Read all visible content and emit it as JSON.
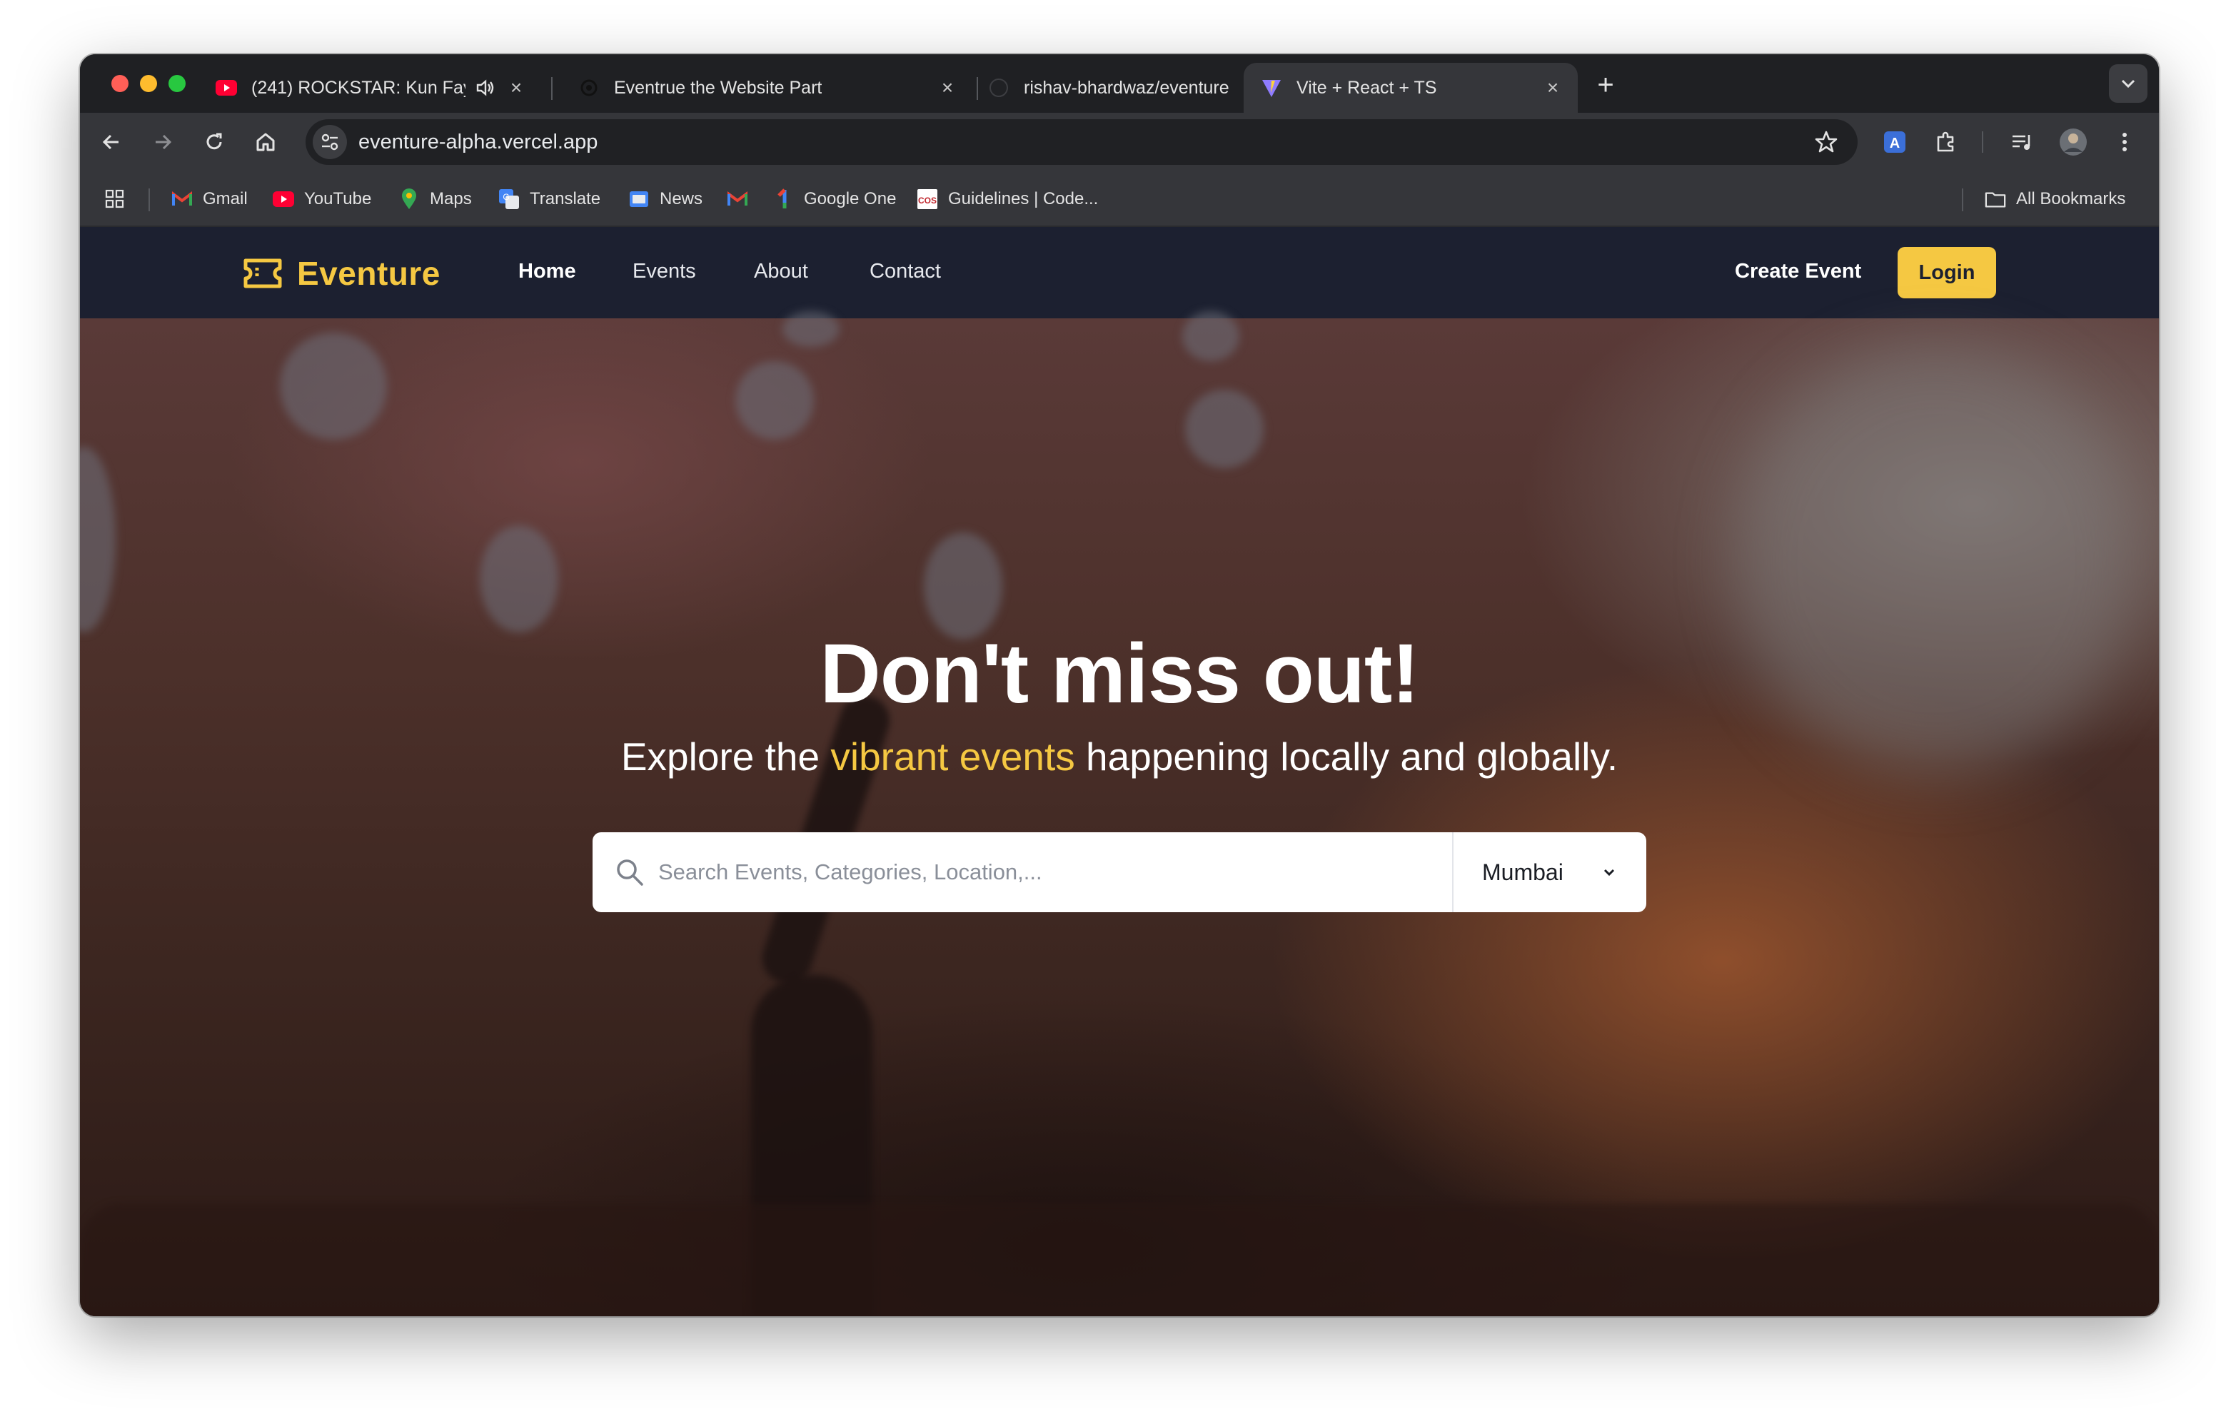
{
  "browser": {
    "tabs": [
      {
        "title": "(241) ROCKSTAR: Kun Faya",
        "favicon": "youtube-icon",
        "audio": true
      },
      {
        "title": "Eventrue the Website Part",
        "favicon": "chatgpt-icon"
      },
      {
        "title": "rishav-bhardwaz/eventure",
        "favicon": "github-icon"
      },
      {
        "title": "Vite + React + TS",
        "favicon": "vite-icon",
        "active": true
      }
    ],
    "url": "eventure-alpha.vercel.app",
    "bookmarks": [
      {
        "label": "Gmail",
        "icon": "gmail-icon"
      },
      {
        "label": "YouTube",
        "icon": "youtube-icon"
      },
      {
        "label": "Maps",
        "icon": "maps-icon"
      },
      {
        "label": "Translate",
        "icon": "translate-icon"
      },
      {
        "label": "News",
        "icon": "news-icon"
      },
      {
        "label": "",
        "icon": "gmail-icon"
      },
      {
        "label": "Google One",
        "icon": "google-one-icon"
      },
      {
        "label": "Guidelines | Code...",
        "icon": "guidelines-icon"
      }
    ],
    "all_bookmarks_label": "All Bookmarks"
  },
  "site": {
    "logo_text": "Eventure",
    "nav": {
      "home": "Home",
      "events": "Events",
      "about": "About",
      "contact": "Contact"
    },
    "create_event": "Create Event",
    "login": "Login"
  },
  "hero": {
    "title": "Don't miss out!",
    "subtitle_before": "Explore the ",
    "subtitle_highlight": "vibrant events",
    "subtitle_after": " happening locally and globally.",
    "search_placeholder": "Search Events, Categories, Location,...",
    "city": "Mumbai"
  },
  "colors": {
    "accent_yellow": "#f5c842",
    "navbar_bg": "#1c2030",
    "browser_chrome": "#35363a"
  }
}
